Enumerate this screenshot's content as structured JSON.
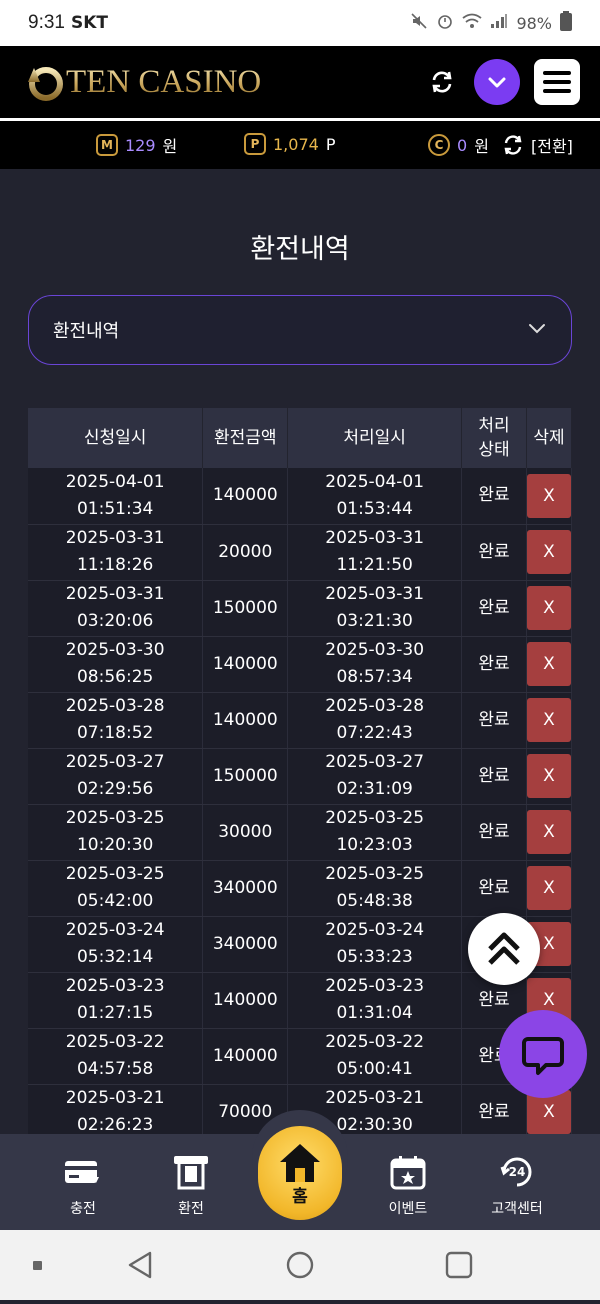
{
  "status_bar": {
    "time": "9:31",
    "carrier": "SKT",
    "battery": "98%"
  },
  "header": {
    "logo_text": "TEN CASINO"
  },
  "balance": {
    "money": {
      "badge": "M",
      "value": "129",
      "unit": "원"
    },
    "points": {
      "badge": "P",
      "value": "1,074",
      "unit": "P"
    },
    "casino": {
      "badge": "C",
      "value": "0",
      "unit": "원"
    },
    "exchange_label": "[전환]"
  },
  "page": {
    "title": "환전내역",
    "select_value": "환전내역"
  },
  "table": {
    "headers": [
      "신청일시",
      "환전금액",
      "처리일시",
      "처리상태",
      "삭제"
    ],
    "rows": [
      {
        "req_date": "2025-04-01",
        "req_time": "01:51:34",
        "amount": "140000",
        "proc_date": "2025-04-01",
        "proc_time": "01:53:44",
        "status": "완료",
        "delete": "X"
      },
      {
        "req_date": "2025-03-31",
        "req_time": "11:18:26",
        "amount": "20000",
        "proc_date": "2025-03-31",
        "proc_time": "11:21:50",
        "status": "완료",
        "delete": "X"
      },
      {
        "req_date": "2025-03-31",
        "req_time": "03:20:06",
        "amount": "150000",
        "proc_date": "2025-03-31",
        "proc_time": "03:21:30",
        "status": "완료",
        "delete": "X"
      },
      {
        "req_date": "2025-03-30",
        "req_time": "08:56:25",
        "amount": "140000",
        "proc_date": "2025-03-30",
        "proc_time": "08:57:34",
        "status": "완료",
        "delete": "X"
      },
      {
        "req_date": "2025-03-28",
        "req_time": "07:18:52",
        "amount": "140000",
        "proc_date": "2025-03-28",
        "proc_time": "07:22:43",
        "status": "완료",
        "delete": "X"
      },
      {
        "req_date": "2025-03-27",
        "req_time": "02:29:56",
        "amount": "150000",
        "proc_date": "2025-03-27",
        "proc_time": "02:31:09",
        "status": "완료",
        "delete": "X"
      },
      {
        "req_date": "2025-03-25",
        "req_time": "10:20:30",
        "amount": "30000",
        "proc_date": "2025-03-25",
        "proc_time": "10:23:03",
        "status": "완료",
        "delete": "X"
      },
      {
        "req_date": "2025-03-25",
        "req_time": "05:42:00",
        "amount": "340000",
        "proc_date": "2025-03-25",
        "proc_time": "05:48:38",
        "status": "완료",
        "delete": "X"
      },
      {
        "req_date": "2025-03-24",
        "req_time": "05:32:14",
        "amount": "340000",
        "proc_date": "2025-03-24",
        "proc_time": "05:33:23",
        "status": "완료",
        "delete": "X"
      },
      {
        "req_date": "2025-03-23",
        "req_time": "01:27:15",
        "amount": "140000",
        "proc_date": "2025-03-23",
        "proc_time": "01:31:04",
        "status": "완료",
        "delete": "X"
      },
      {
        "req_date": "2025-03-22",
        "req_time": "04:57:58",
        "amount": "140000",
        "proc_date": "2025-03-22",
        "proc_time": "05:00:41",
        "status": "완료",
        "delete": "X"
      },
      {
        "req_date": "2025-03-21",
        "req_time": "02:26:23",
        "amount": "70000",
        "proc_date": "2025-03-21",
        "proc_time": "02:30:30",
        "status": "완료",
        "delete": "X"
      }
    ]
  },
  "bottom_nav": {
    "deposit": "충전",
    "withdraw": "환전",
    "home": "홈",
    "event": "이벤트",
    "support": "고객센터"
  },
  "colors": {
    "accent_purple": "#7b3cf2",
    "gold": "#f2b72a",
    "delete_red": "#a53f3f",
    "background": "#22232f"
  }
}
